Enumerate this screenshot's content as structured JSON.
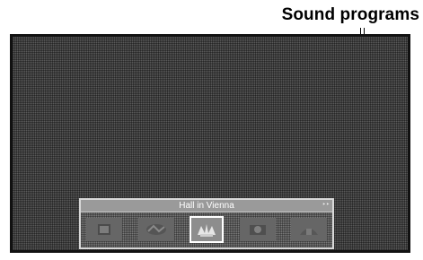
{
  "callout": {
    "label": "Sound programs"
  },
  "overlay": {
    "title": "Hall in Vienna",
    "corner_icon": "resize-icon"
  },
  "programs": [
    {
      "icon": "program-thumbnail-1-icon",
      "selected": false
    },
    {
      "icon": "program-thumbnail-2-icon",
      "selected": false
    },
    {
      "icon": "hall-in-vienna-icon",
      "selected": true
    },
    {
      "icon": "program-thumbnail-4-icon",
      "selected": false
    },
    {
      "icon": "program-thumbnail-5-icon",
      "selected": false
    }
  ],
  "colors": {
    "screen": "#5a5a5a",
    "overlay": "#7a7a7a",
    "title_bar": "#9a9a9a",
    "selection_border": "#ffffff"
  }
}
